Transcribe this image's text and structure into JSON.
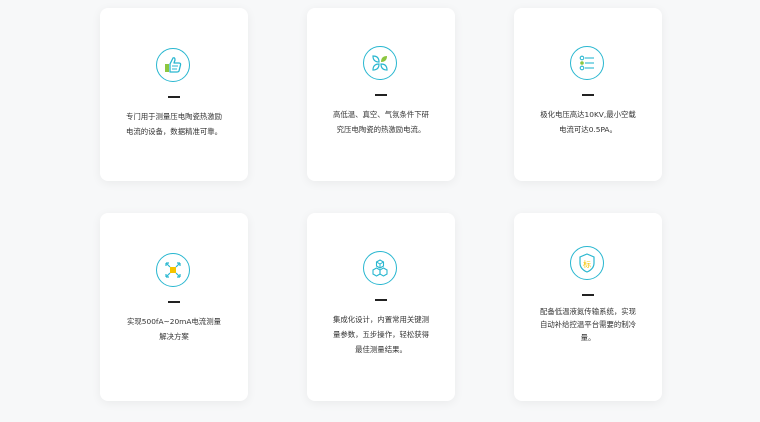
{
  "features": [
    {
      "icon": "thumbs-up-icon",
      "lines": [
        "专门用于测量压电陶瓷热激励",
        "电流的设备，数据精准可靠。"
      ]
    },
    {
      "icon": "clover-leaves-icon",
      "lines": [
        "高低温、真空、气氛条件下研",
        "究压电陶瓷的热激励电流。"
      ]
    },
    {
      "icon": "list-settings-icon",
      "lines": [
        "极化电压高达10KV,最小空载",
        "电流可达0.5PA。"
      ]
    },
    {
      "icon": "expand-arrows-icon",
      "lines": [
        "实现500fA~20mA电流测量",
        "解决方案"
      ]
    },
    {
      "icon": "cubes-icon",
      "lines": [
        "集成化设计，内置常用关键测",
        "量参数，五步操作，轻松获得",
        "最佳测量结果。"
      ]
    },
    {
      "icon": "shield-badge-icon",
      "icon_text": "标",
      "lines": [
        "配备低温液氮传输系统，实现",
        "自动补给控温平台需要的制冷",
        "量。"
      ]
    }
  ],
  "colors": {
    "accent": "#29b7d0",
    "accent_green": "#8cc63f",
    "accent_yellow": "#f5c400",
    "text": "#333333",
    "background": "#f7f8f9"
  }
}
